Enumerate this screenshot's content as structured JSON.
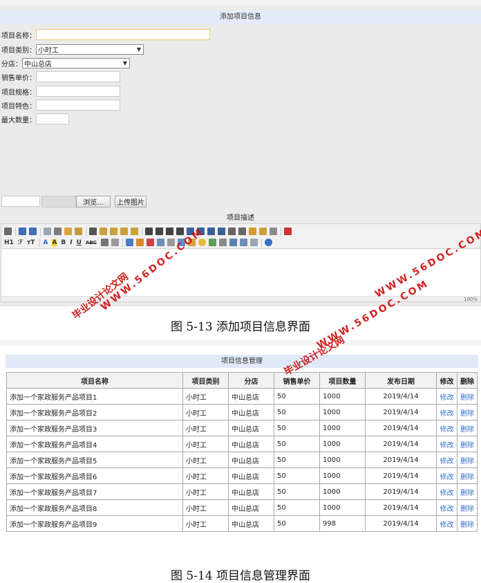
{
  "form": {
    "header": "添加项目信息",
    "name_label": "项目名称：",
    "name_value": "",
    "category_label": "项目类别：",
    "category_value": "小时工",
    "branch_label": "分店：",
    "branch_value": "中山总店",
    "price_label": "销售单价：",
    "price_value": "",
    "spec_label": "项目规格：",
    "spec_value": "",
    "feature_label": "项目特色：",
    "feature_value": "",
    "maxqty_label": "最大数量：",
    "maxqty_value": "",
    "browse_label": "浏览...",
    "upload_label": "上传图片",
    "desc_title": "项目描述",
    "editor_status": "100%"
  },
  "editor_toolbar": {
    "heading_label": "H1",
    "font_label": "ℱ",
    "size_label": "тT",
    "forecolor_label": "A",
    "backcolor_label": "A",
    "bold_label": "B",
    "italic_label": "I",
    "underline_label": "U",
    "strike_label": "ABC"
  },
  "watermarks": {
    "site": "WWW.56DOC.COM",
    "cn": "毕业设计论文网"
  },
  "captions": {
    "fig13": "图 5-13 添加项目信息界面",
    "fig14": "图 5-14 项目信息管理界面"
  },
  "management": {
    "header": "项目信息管理",
    "columns": [
      "项目名称",
      "项目类别",
      "分店",
      "销售单价",
      "项目数量",
      "发布日期",
      "修改",
      "删除"
    ],
    "rows": [
      [
        "添加一个家政服务产品项目1",
        "小时工",
        "中山总店",
        "50",
        "1000",
        "2019/4/14",
        "修改",
        "删除"
      ],
      [
        "添加一个家政服务产品项目2",
        "小时工",
        "中山总店",
        "50",
        "1000",
        "2019/4/14",
        "修改",
        "删除"
      ],
      [
        "添加一个家政服务产品项目3",
        "小时工",
        "中山总店",
        "50",
        "1000",
        "2019/4/14",
        "修改",
        "删除"
      ],
      [
        "添加一个家政服务产品项目4",
        "小时工",
        "中山总店",
        "50",
        "1000",
        "2019/4/14",
        "修改",
        "删除"
      ],
      [
        "添加一个家政服务产品项目5",
        "小时工",
        "中山总店",
        "50",
        "1000",
        "2019/4/14",
        "修改",
        "删除"
      ],
      [
        "添加一个家政服务产品项目6",
        "小时工",
        "中山总店",
        "50",
        "1000",
        "2019/4/14",
        "修改",
        "删除"
      ],
      [
        "添加一个家政服务产品项目7",
        "小时工",
        "中山总店",
        "50",
        "1000",
        "2019/4/14",
        "修改",
        "删除"
      ],
      [
        "添加一个家政服务产品项目8",
        "小时工",
        "中山总店",
        "50",
        "1000",
        "2019/4/14",
        "修改",
        "删除"
      ],
      [
        "添加一个家政服务产品项目9",
        "小时工",
        "中山总店",
        "50",
        "998",
        "2019/4/14",
        "修改",
        "删除"
      ]
    ]
  }
}
